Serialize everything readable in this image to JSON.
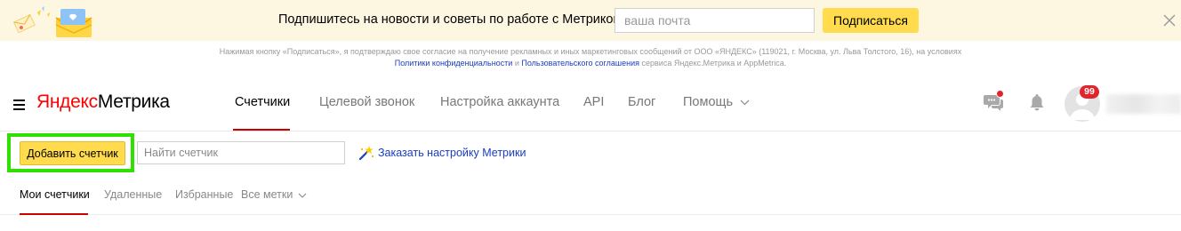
{
  "banner": {
    "text": "Подпишитесь на новости и советы по работе с Метрикой",
    "email_placeholder": "ваша почта",
    "subscribe_label": "Подписаться"
  },
  "legal": {
    "line1": "Нажимая кнопку «Подписаться», я подтверждаю свое согласие на получение рекламных и иных маркетинговых сообщений от ООО «ЯНДЕКС» (119021, г. Москва, ул. Льва Толстого, 16), на условиях",
    "privacy_link": "Политики конфиденциальности",
    "and": "и",
    "terms_link": "Пользовательского соглашения",
    "tail": "сервиса Яндекс.Метрика и AppMetrica."
  },
  "header": {
    "logo_brand": "Яндекс",
    "logo_product": "Метрика",
    "nav": [
      {
        "label": "Счетчики",
        "active": true
      },
      {
        "label": "Целевой звонок"
      },
      {
        "label": "Настройка аккаунта"
      },
      {
        "label": "API"
      },
      {
        "label": "Блог"
      },
      {
        "label": "Помощь"
      }
    ],
    "notification_count": "99"
  },
  "toolbar": {
    "add_counter_label": "Добавить счетчик",
    "search_placeholder": "Найти счетчик",
    "order_setup_label": "Заказать настройку Метрики"
  },
  "tabs": [
    {
      "label": "Мои счетчики",
      "active": true
    },
    {
      "label": "Удаленные"
    },
    {
      "label": "Избранные"
    },
    {
      "label": "Все метки"
    }
  ],
  "colors": {
    "accent_yellow": "#ffdb4d",
    "link_blue": "#1a3dc1",
    "active_red": "#cc0000",
    "highlight_green": "#2fe000",
    "banner_bg": "#fdf6e1"
  },
  "icons": {
    "banner_art": "envelope-illustration-icon",
    "close": "close-icon",
    "menu": "hamburger-menu-icon",
    "chat": "chat-icon",
    "bell": "bell-icon",
    "avatar": "avatar-icon",
    "help_chevron": "chevron-down-icon",
    "order": "magic-wand-icon",
    "tabs_chevron": "chevron-down-icon"
  }
}
